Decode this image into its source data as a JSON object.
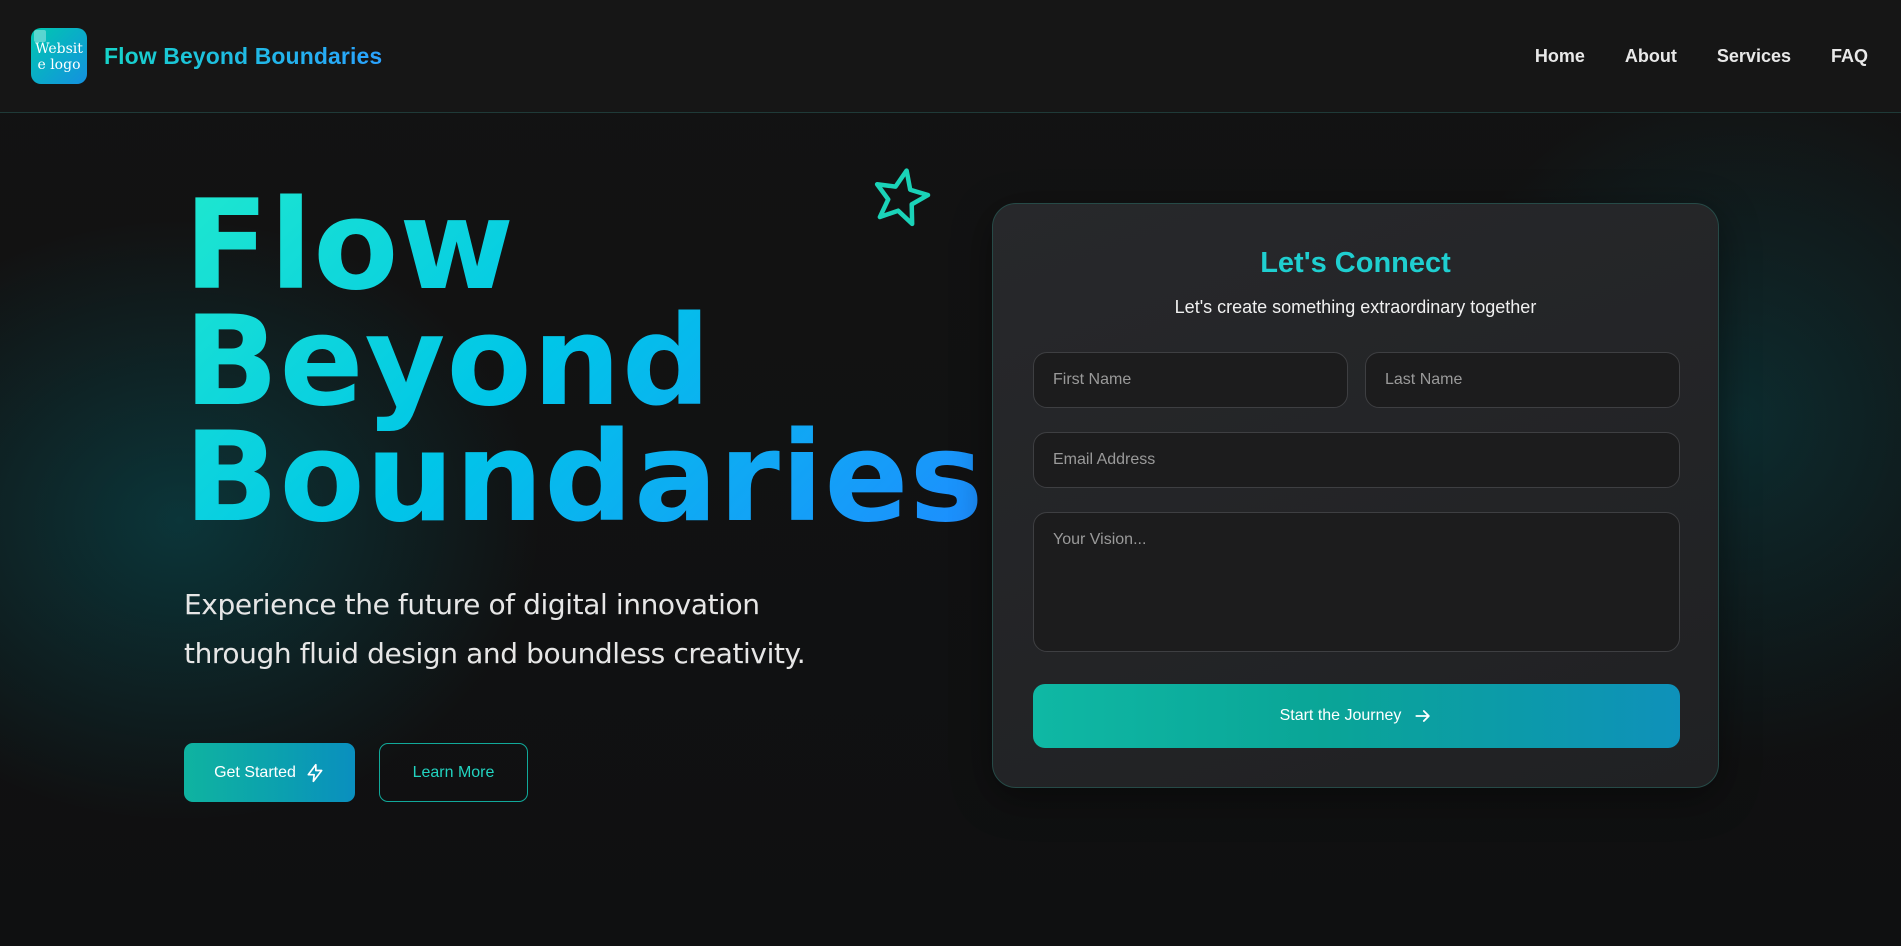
{
  "header": {
    "logo_alt": "Website logo",
    "brand": "Flow Beyond Boundaries",
    "nav": [
      {
        "label": "Home"
      },
      {
        "label": "About"
      },
      {
        "label": "Services"
      },
      {
        "label": "FAQ"
      }
    ]
  },
  "hero": {
    "title_lines": [
      "Flow",
      "Beyond",
      "Boundaries"
    ],
    "subtitle": "Experience the future of digital innovation through fluid design and boundless creativity.",
    "primary_button": {
      "label": "Get Started",
      "icon": "lightning-icon"
    },
    "secondary_button": {
      "label": "Learn More"
    },
    "decoration_icon": "star-outline-icon"
  },
  "form": {
    "title": "Let's Connect",
    "subtitle": "Let's create something extraordinary together",
    "first_name_placeholder": "First Name",
    "last_name_placeholder": "Last Name",
    "email_placeholder": "Email Address",
    "vision_placeholder": "Your Vision...",
    "submit": {
      "label": "Start the Journey",
      "icon": "arrow-right-icon"
    }
  },
  "colors": {
    "accent_teal": "#1fcfd0",
    "accent_blue": "#1e8cff",
    "background": "#121212",
    "card": "#242527"
  }
}
